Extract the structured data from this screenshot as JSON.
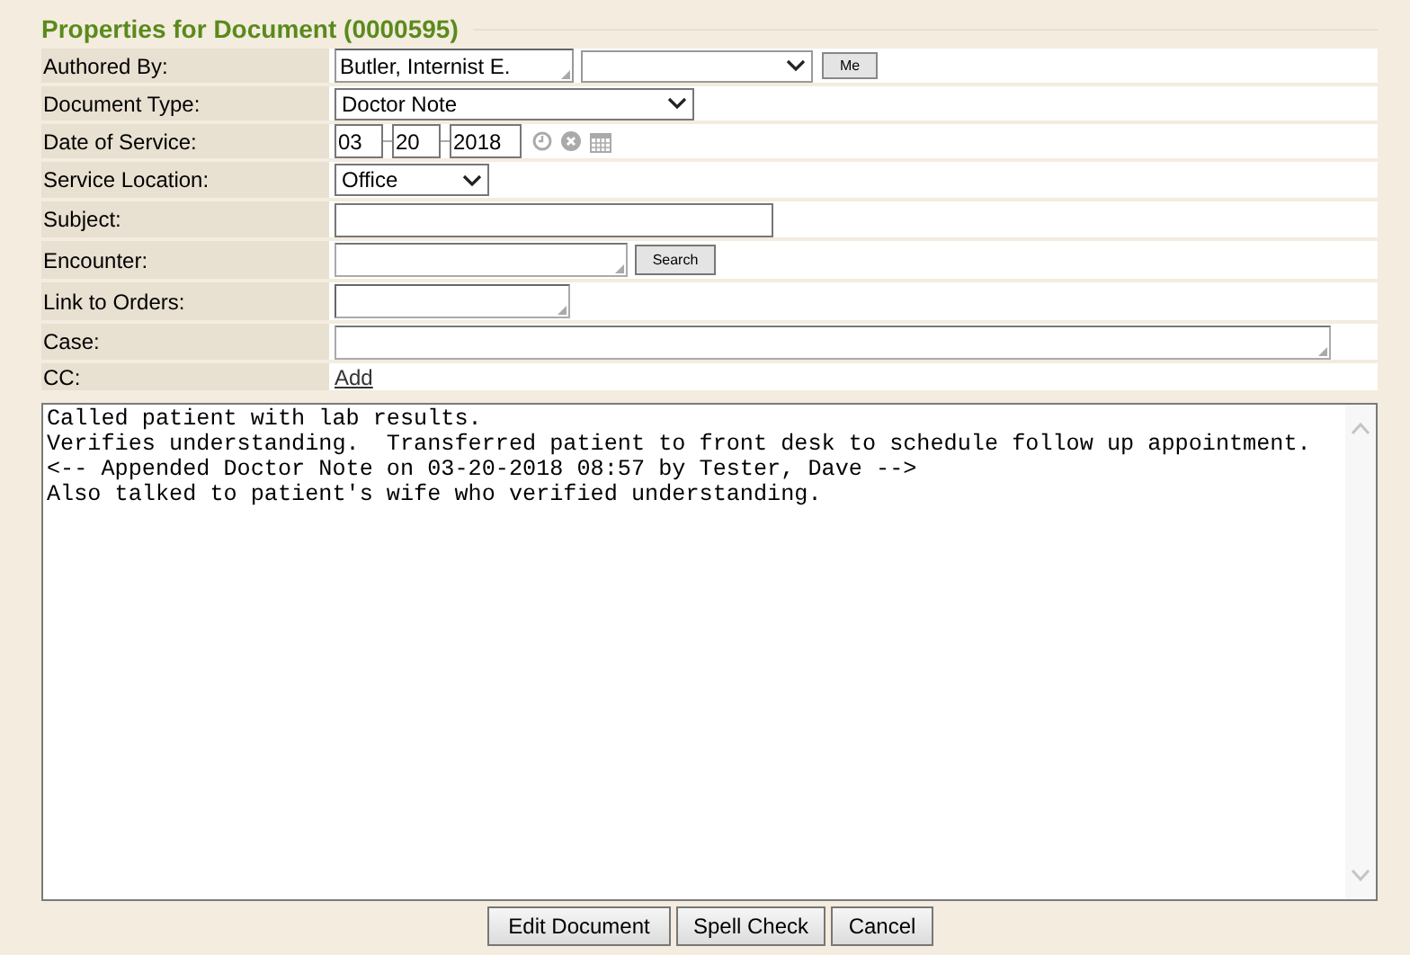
{
  "title": "Properties for Document (0000595)",
  "rows": [
    {
      "label": "Authored By:",
      "kind": "author",
      "value": "Butler, Internist E.",
      "button": "Me"
    },
    {
      "label": "Document Type:",
      "kind": "select",
      "value": "Doctor Note"
    },
    {
      "label": "Date of Service:",
      "kind": "date",
      "month": "03",
      "day": "20",
      "year": "2018"
    },
    {
      "label": "Service Location:",
      "kind": "select",
      "value": "Office"
    },
    {
      "label": "Subject:",
      "kind": "text"
    },
    {
      "label": "Encounter:",
      "kind": "search",
      "button": "Search"
    },
    {
      "label": "Link to Orders:",
      "kind": "small"
    },
    {
      "label": "Case:",
      "kind": "wide"
    },
    {
      "label": "CC:",
      "kind": "link",
      "link": "Add"
    }
  ],
  "note_lines": [
    "Called patient with lab results.",
    "Verifies understanding.  Transferred patient to front desk to schedule follow up appointment.",
    "<-- Appended Doctor Note on 03-20-2018 08:57 by Tester, Dave -->",
    "Also talked to patient's wife who verified understanding."
  ],
  "buttons": [
    "Edit Document",
    "Spell Check",
    "Cancel"
  ]
}
